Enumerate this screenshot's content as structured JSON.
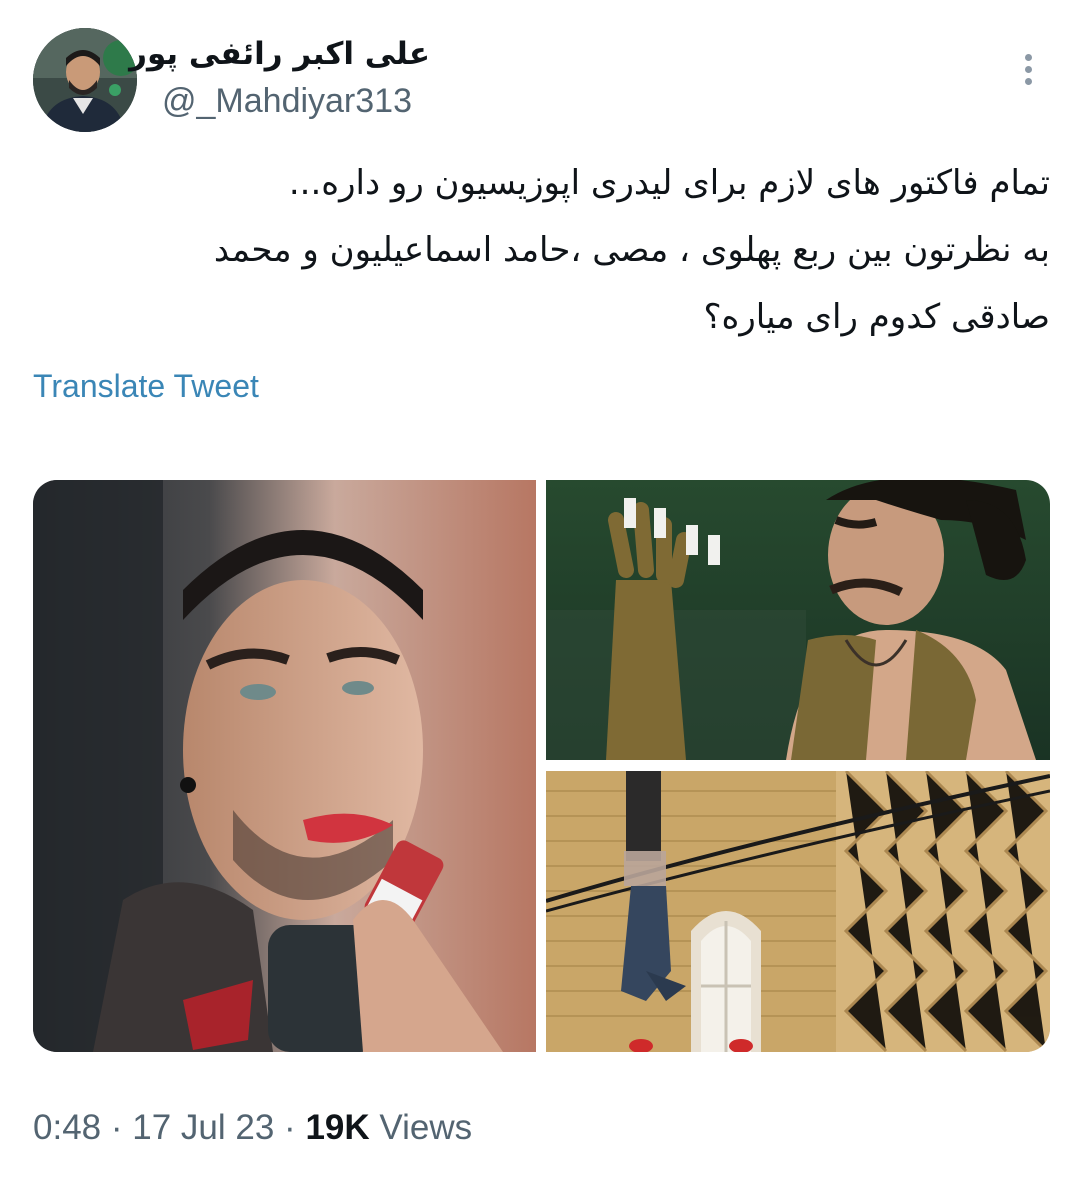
{
  "author": {
    "display_name": "علی اکبر رائفی پور",
    "handle": "@_Mahdiyar313",
    "avatar_icon": "profile-photo"
  },
  "more_icon": "more-vertical-icon",
  "tweet": {
    "lines": [
      "تمام فاکتور های لازم برای لیدری اپوزیسیون رو داره...",
      "به نظرتون بین ربع پهلوی ، مصی ،حامد اسماعیلیون  و محمد",
      "صادقی کدوم رای میاره؟"
    ],
    "translate_label": "Translate Tweet"
  },
  "meta": {
    "time": "0:48",
    "separator": "·",
    "date": "17 Jul 23",
    "views_count": "19K",
    "views_label": "Views"
  },
  "colors": {
    "text_primary": "#0f1419",
    "text_secondary": "#536471",
    "link": "#3a86b6",
    "background": "#ffffff"
  }
}
